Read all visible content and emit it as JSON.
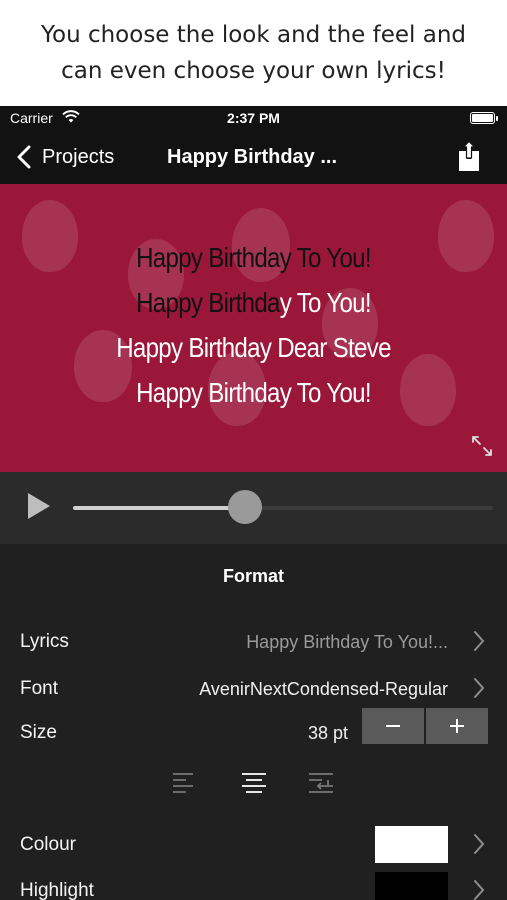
{
  "caption": {
    "line1": "You choose the look and the feel and",
    "line2": "can even choose your own lyrics!"
  },
  "status_bar": {
    "carrier": "Carrier",
    "time": "2:37 PM"
  },
  "nav": {
    "back_label": "Projects",
    "title": "Happy Birthday ...",
    "share_icon": "share-icon"
  },
  "preview": {
    "background": "#9a1739",
    "lines": [
      {
        "sung": "Happy Birthday To You!",
        "rest": ""
      },
      {
        "sung": "Happy Birthda",
        "rest": "y To You!"
      },
      {
        "sung": "",
        "rest": "Happy Birthday Dear Steve"
      },
      {
        "sung": "",
        "rest": "Happy Birthday To You!"
      }
    ]
  },
  "player": {
    "progress": 0.41
  },
  "format": {
    "heading": "Format",
    "lyrics": {
      "label": "Lyrics",
      "value": "Happy Birthday To You!..."
    },
    "font": {
      "label": "Font",
      "value": "AvenirNextCondensed-Regular"
    },
    "size": {
      "label": "Size",
      "value": "38 pt",
      "minus": "−",
      "plus": "+"
    },
    "alignment_options": [
      "align-left",
      "align-center",
      "align-justify-wrap"
    ],
    "colour": {
      "label": "Colour",
      "value": "#ffffff"
    },
    "highlight": {
      "label": "Highlight",
      "value": "#000000"
    }
  }
}
